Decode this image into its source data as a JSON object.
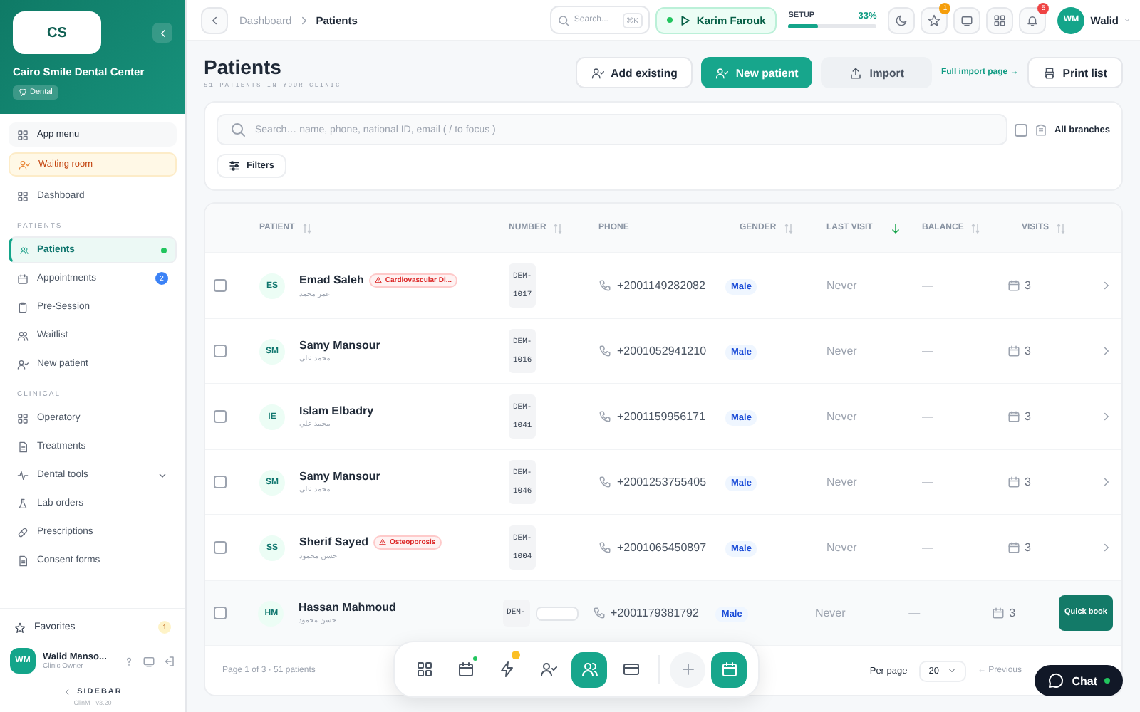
{
  "clinic": {
    "initials": "CS",
    "name": "Cairo Smile Dental Center",
    "tag": "Dental"
  },
  "sidebar": {
    "quick": [
      {
        "label": "App menu",
        "kind": "menu"
      },
      {
        "label": "Waiting room",
        "kind": "waiting"
      }
    ],
    "sections": [
      {
        "items": [
          {
            "label": "Dashboard",
            "selected": false,
            "dot": false,
            "expandable": false
          }
        ]
      },
      {
        "heading": "PATIENTS",
        "items": [
          {
            "label": "Patients",
            "selected": true,
            "dot": true,
            "expandable": false
          },
          {
            "label": "Appointments",
            "selected": false,
            "badge": "2",
            "dot": false,
            "expandable": false
          },
          {
            "label": "Pre-Session",
            "selected": false,
            "dot": false,
            "expandable": false
          },
          {
            "label": "Waitlist",
            "selected": false,
            "dot": false,
            "expandable": false
          },
          {
            "label": "New patient",
            "selected": false,
            "dot": false,
            "expandable": false
          }
        ]
      },
      {
        "heading": "CLINICAL",
        "items": [
          {
            "label": "Operatory",
            "selected": false,
            "dot": false,
            "expandable": false
          },
          {
            "label": "Treatments",
            "selected": false,
            "dot": false,
            "expandable": false
          },
          {
            "label": "Dental tools",
            "selected": false,
            "dot": false,
            "expandable": true
          },
          {
            "label": "Lab orders",
            "selected": false,
            "dot": false,
            "expandable": false
          },
          {
            "label": "Prescriptions",
            "selected": false,
            "dot": false,
            "expandable": false
          },
          {
            "label": "Consent forms",
            "selected": false,
            "dot": false,
            "expandable": false
          }
        ]
      }
    ],
    "favorites": {
      "label": "Favorites",
      "count": "1"
    },
    "user": {
      "initials": "WM",
      "name": "Walid Manso...",
      "role": "Clinic Owner"
    },
    "collapse": "SIDEBAR",
    "version": "ClinM · v3.20"
  },
  "topbar": {
    "breadcrumb": [
      "Dashboard",
      "Patients"
    ],
    "search_placeholder": "Search...",
    "shortcut": "⌘K",
    "active_patient": "Karim Farouk",
    "setup_label": "SETUP",
    "setup_percent": "33%",
    "setup": {
      "level": 0.33
    },
    "star_badge": "1",
    "bell_badge": "5",
    "user_initials": "WM",
    "user_name": "Walid"
  },
  "page": {
    "title": "Patients",
    "subtitle": "51 PATIENTS IN YOUR CLINIC",
    "actions": [
      {
        "label": "Add existing",
        "kind": "outline"
      },
      {
        "label": "New patient",
        "kind": "primary"
      },
      {
        "label": "Import",
        "kind": "muted"
      },
      {
        "label": "Full import page →",
        "kind": "link"
      },
      {
        "label": "Print list",
        "kind": "outline"
      }
    ]
  },
  "filters": {
    "search_placeholder": "Search… name, phone, national ID, email ( / to focus )",
    "all_branches": {
      "label": "All branches",
      "checked": false
    },
    "button": "Filters"
  },
  "table": {
    "columns": [
      {
        "label": "PATIENT",
        "sortable": true,
        "sorted": false
      },
      {
        "label": "NUMBER",
        "sortable": true,
        "sorted": false
      },
      {
        "label": "PHONE",
        "sortable": false,
        "sorted": false
      },
      {
        "label": "GENDER",
        "sortable": true,
        "sorted": false
      },
      {
        "label": "LAST VISIT",
        "sortable": true,
        "sorted": true
      },
      {
        "label": "BALANCE",
        "sortable": true,
        "sorted": false
      },
      {
        "label": "VISITS",
        "sortable": true,
        "sorted": false
      }
    ],
    "rows": [
      {
        "checked": false,
        "initials": "ES",
        "name": "Emad Saleh",
        "condition": "Cardiovascular Di...",
        "subname": "عمر محمد",
        "number": [
          "DEM-",
          "1017"
        ],
        "phone": "+2001149282082",
        "gender": "Male",
        "last_visit": "Never",
        "balance": "—",
        "visits": "3",
        "handle": false,
        "action": {
          "kind": "chevron"
        }
      },
      {
        "checked": false,
        "initials": "SM",
        "name": "Samy Mansour",
        "subname": "محمد علي",
        "number": [
          "DEM-",
          "1016"
        ],
        "phone": "+2001052941210",
        "gender": "Male",
        "last_visit": "Never",
        "balance": "—",
        "visits": "3",
        "handle": false,
        "action": {
          "kind": "chevron"
        }
      },
      {
        "checked": false,
        "initials": "IE",
        "name": "Islam Elbadry",
        "subname": "محمد علي",
        "number": [
          "DEM-",
          "1041"
        ],
        "phone": "+2001159956171",
        "gender": "Male",
        "last_visit": "Never",
        "balance": "—",
        "visits": "3",
        "handle": false,
        "action": {
          "kind": "chevron"
        }
      },
      {
        "checked": false,
        "initials": "SM",
        "name": "Samy Mansour",
        "subname": "محمد علي",
        "number": [
          "DEM-",
          "1046"
        ],
        "phone": "+2001253755405",
        "gender": "Male",
        "last_visit": "Never",
        "balance": "—",
        "visits": "3",
        "handle": false,
        "action": {
          "kind": "chevron"
        }
      },
      {
        "checked": false,
        "initials": "SS",
        "name": "Sherif Sayed",
        "condition": "Osteoporosis",
        "subname": "حسن محمود",
        "number": [
          "DEM-",
          "1004"
        ],
        "phone": "+2001065450897",
        "gender": "Male",
        "last_visit": "Never",
        "balance": "—",
        "visits": "3",
        "handle": false,
        "action": {
          "kind": "chevron"
        }
      },
      {
        "checked": false,
        "initials": "HM",
        "name": "Hassan Mahmoud",
        "subname": "حسن محمود",
        "number": [
          "DEM-"
        ],
        "phone": "+2001179381792",
        "gender": "Male",
        "last_visit": "Never",
        "balance": "—",
        "visits": "3",
        "handle": true,
        "action": {
          "kind": "quick_book",
          "label": "Quick book"
        }
      }
    ],
    "pagination": {
      "summary": "Page 1 of 3 · 51 patients",
      "per_page_label": "Per page",
      "per_page": "20",
      "previous": "← Previous"
    }
  },
  "dock": [
    {
      "selected": false,
      "dot": false,
      "star": false
    },
    {
      "selected": false,
      "dot": true,
      "star": false
    },
    {
      "selected": false,
      "dot": false,
      "star": true
    },
    {
      "selected": false,
      "dot": false,
      "star": false
    },
    {
      "selected": true,
      "dot": false,
      "star": false
    },
    {
      "selected": false,
      "dot": false,
      "star": false
    }
  ],
  "chat": {
    "label": "Chat",
    "online": true
  }
}
